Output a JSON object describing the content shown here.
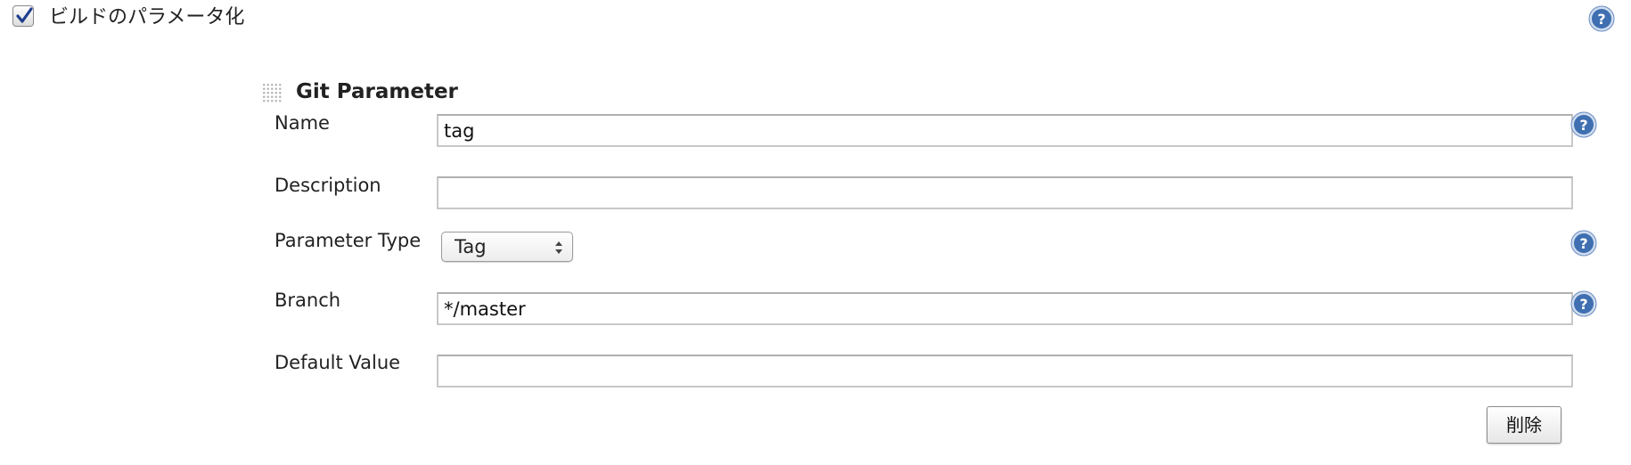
{
  "parameterized": {
    "checked": true,
    "label": "ビルドのパラメータ化",
    "help_icon": "help-icon"
  },
  "git_parameter": {
    "title": "Git Parameter",
    "drag_icon": "drag-handle-icon",
    "fields": {
      "name": {
        "label": "Name",
        "value": "tag"
      },
      "description": {
        "label": "Description",
        "value": ""
      },
      "parameter_type": {
        "label": "Parameter Type",
        "selected": "Tag"
      },
      "branch": {
        "label": "Branch",
        "value": "*/master"
      },
      "default_value": {
        "label": "Default Value",
        "value": ""
      }
    },
    "delete_label": "削除"
  },
  "colors": {
    "help_icon_fill": "#3f6fb1",
    "checkmark": "#1f3f8c",
    "field_border": "#c8c8c8"
  }
}
